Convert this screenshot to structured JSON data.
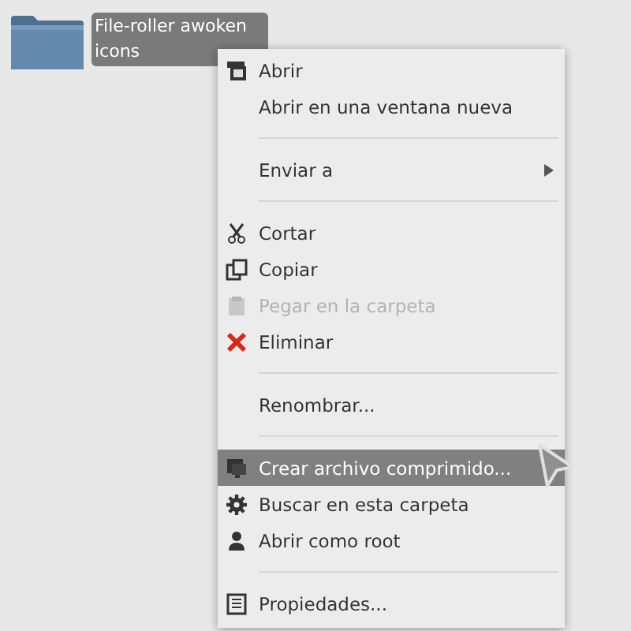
{
  "desktop_icon": {
    "label": "File-roller awoken icons",
    "selected": true
  },
  "context_menu": {
    "items": [
      {
        "kind": "item",
        "label": "Abrir",
        "disabled": false,
        "selected": false,
        "submenu": false
      },
      {
        "kind": "item",
        "label": "Abrir en una ventana nueva",
        "disabled": false,
        "selected": false,
        "submenu": false
      },
      {
        "kind": "separator"
      },
      {
        "kind": "item",
        "label": "Enviar a",
        "disabled": false,
        "selected": false,
        "submenu": true
      },
      {
        "kind": "separator"
      },
      {
        "kind": "item",
        "label": "Cortar",
        "disabled": false,
        "selected": false,
        "submenu": false
      },
      {
        "kind": "item",
        "label": "Copiar",
        "disabled": false,
        "selected": false,
        "submenu": false
      },
      {
        "kind": "item",
        "label": "Pegar en la carpeta",
        "disabled": true,
        "selected": false,
        "submenu": false
      },
      {
        "kind": "item",
        "label": "Eliminar",
        "disabled": false,
        "selected": false,
        "submenu": false
      },
      {
        "kind": "separator"
      },
      {
        "kind": "item",
        "label": "Renombrar...",
        "disabled": false,
        "selected": false,
        "submenu": false
      },
      {
        "kind": "separator"
      },
      {
        "kind": "item",
        "label": "Crear archivo comprimido...",
        "disabled": false,
        "selected": true,
        "submenu": false
      },
      {
        "kind": "item",
        "label": "Buscar en esta carpeta",
        "disabled": false,
        "selected": false,
        "submenu": false
      },
      {
        "kind": "item",
        "label": "Abrir como root",
        "disabled": false,
        "selected": false,
        "submenu": false
      },
      {
        "kind": "separator"
      },
      {
        "kind": "item",
        "label": "Propiedades...",
        "disabled": false,
        "selected": false,
        "submenu": false
      }
    ]
  }
}
